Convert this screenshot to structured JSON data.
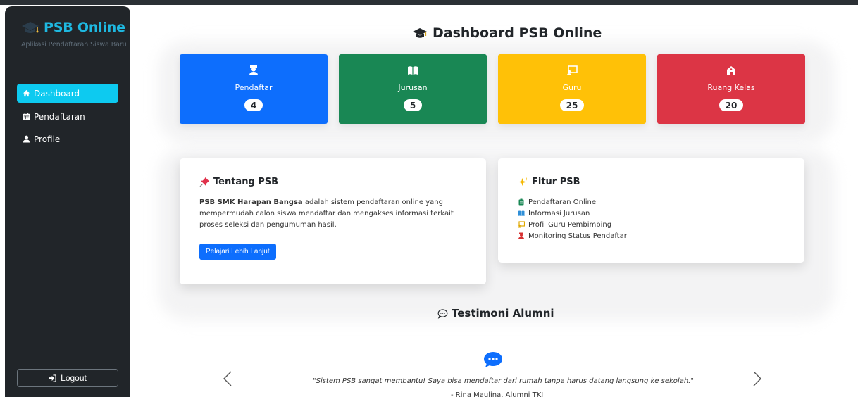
{
  "sidebar": {
    "brand_title": "PSB Online",
    "brand_subtitle": "Aplikasi Pendaftaran Siswa Baru",
    "items": [
      {
        "label": "Dashboard",
        "icon": "home-icon",
        "active": true
      },
      {
        "label": "Pendaftaran",
        "icon": "calendar-icon",
        "active": false
      },
      {
        "label": "Profile",
        "icon": "user-icon",
        "active": false
      }
    ],
    "logout_label": "Logout"
  },
  "main": {
    "title": "Dashboard PSB Online",
    "stats": [
      {
        "label": "Pendaftar",
        "value": "4",
        "icon": "student-icon",
        "color": "#0d6efd"
      },
      {
        "label": "Jurusan",
        "value": "5",
        "icon": "book-icon",
        "color": "#198754"
      },
      {
        "label": "Guru",
        "value": "25",
        "icon": "teacher-board-icon",
        "color": "#ffc107"
      },
      {
        "label": "Ruang Kelas",
        "value": "20",
        "icon": "school-icon",
        "color": "#dc3545"
      }
    ],
    "about": {
      "title": "Tentang PSB",
      "bold_text": "PSB SMK Harapan Bangsa",
      "text": " adalah sistem pendaftaran online yang mempermudah calon siswa mendaftar dan mengakses informasi terkait proses seleksi dan pengumuman hasil.",
      "button": "Pelajari Lebih Lanjut"
    },
    "features": {
      "title": "Fitur PSB",
      "items": [
        {
          "label": "Pendaftaran Online",
          "icon": "clipboard-icon"
        },
        {
          "label": "Informasi Jurusan",
          "icon": "book-icon"
        },
        {
          "label": "Profil Guru Pembimbing",
          "icon": "teacher-board-icon"
        },
        {
          "label": "Monitoring Status Pendaftar",
          "icon": "student-icon"
        }
      ]
    },
    "testimonials": {
      "title": "Testimoni Alumni",
      "quote": "\"Sistem PSB sangat membantu! Saya bisa mendaftar dari rumah tanpa harus datang langsung ke sekolah.\"",
      "author": "- Rina Maulina, Alumni TKJ"
    }
  },
  "colors": {
    "sidebar_bg": "#212529",
    "accent": "#0dcaf0",
    "primary": "#0d6efd"
  }
}
